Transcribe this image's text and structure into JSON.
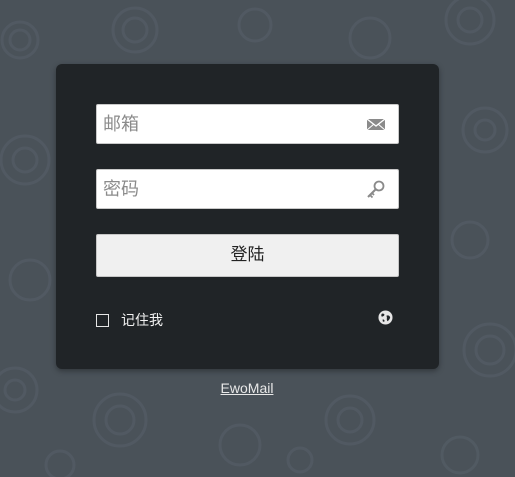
{
  "background": {
    "color": "#4a5259",
    "panel_color": "#202427"
  },
  "form": {
    "email": {
      "placeholder": "邮箱",
      "value": "",
      "icon": "envelope-icon"
    },
    "password": {
      "placeholder": "密码",
      "value": "",
      "icon": "key-icon"
    },
    "login_button": "登陆",
    "remember_me": {
      "label": "记住我",
      "checked": false
    },
    "language_icon": "globe-icon"
  },
  "footer": {
    "link_text": "EwoMail"
  }
}
